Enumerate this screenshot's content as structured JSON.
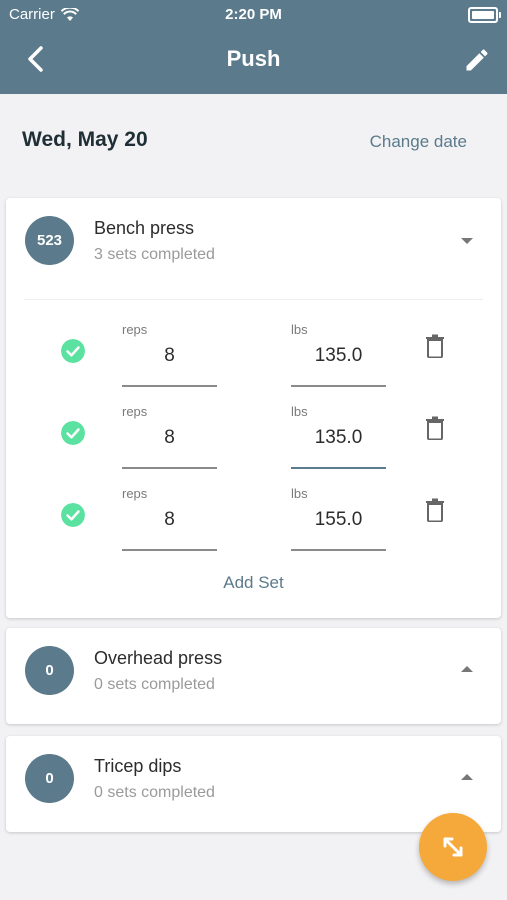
{
  "status_bar": {
    "carrier": "Carrier",
    "time": "2:20 PM"
  },
  "nav": {
    "title": "Push"
  },
  "date_row": {
    "date": "Wed, May 20",
    "change_date_label": "Change date"
  },
  "exercises": [
    {
      "badge": "523",
      "name": "Bench press",
      "summary": "3 sets completed",
      "expanded": true,
      "sets": [
        {
          "reps_label": "reps",
          "reps": "8",
          "lbs_label": "lbs",
          "lbs": "135.0"
        },
        {
          "reps_label": "reps",
          "reps": "8",
          "lbs_label": "lbs",
          "lbs": "135.0"
        },
        {
          "reps_label": "reps",
          "reps": "8",
          "lbs_label": "lbs",
          "lbs": "155.0"
        }
      ],
      "add_set_label": "Add Set"
    },
    {
      "badge": "0",
      "name": "Overhead press",
      "summary": "0 sets completed",
      "expanded": false
    },
    {
      "badge": "0",
      "name": "Tricep dips",
      "summary": "0 sets completed",
      "expanded": false
    }
  ],
  "colors": {
    "header": "#5b7a8b",
    "accent": "#5b7a8b",
    "check": "#5be2a0",
    "fab": "#f5a93a"
  },
  "icons": {
    "back": "chevron-left-icon",
    "edit": "pencil-icon",
    "set_done": "check-circle-icon",
    "delete": "trash-icon",
    "fab": "expand-icon"
  }
}
